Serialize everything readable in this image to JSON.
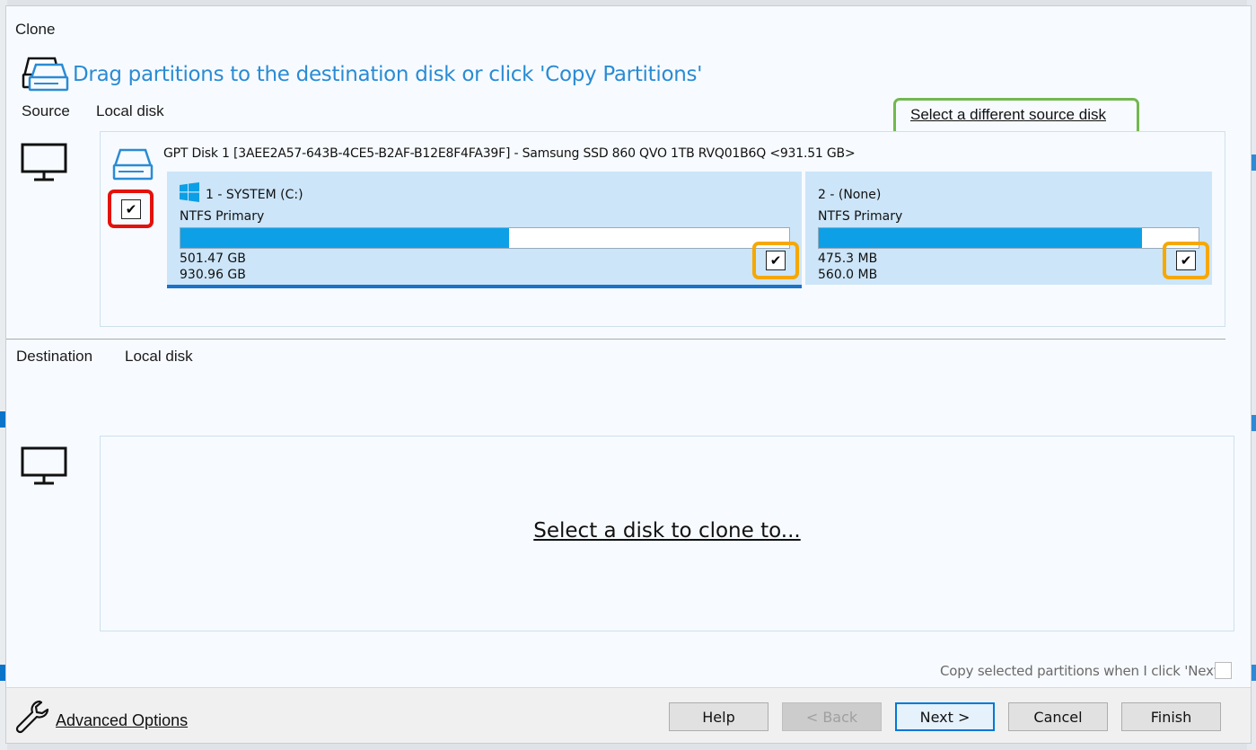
{
  "dialog": {
    "title": "Clone",
    "header": "Drag partitions to the destination disk or click 'Copy Partitions'"
  },
  "source": {
    "label": "Source",
    "type": "Local disk",
    "change_link": "Select a different source disk",
    "disk_title": "GPT Disk 1 [3AEE2A57-643B-4CE5-B2AF-B12E8F4FA39F] - Samsung SSD 860 QVO 1TB RVQ01B6Q  <931.51 GB>",
    "disk_checked": true,
    "partitions": [
      {
        "name": "1 - SYSTEM (C:)",
        "type": "NTFS Primary",
        "used": "501.47 GB",
        "total": "930.96 GB",
        "used_fraction": 0.54,
        "checked": true
      },
      {
        "name": "2 -  (None)",
        "type": "NTFS Primary",
        "used": "475.3 MB",
        "total": "560.0 MB",
        "used_fraction": 0.85,
        "checked": true
      }
    ]
  },
  "destination": {
    "label": "Destination",
    "type": "Local disk",
    "select_link": "Select a disk to clone to..."
  },
  "options": {
    "copy_on_next": "Copy selected partitions when I click 'Next'",
    "copy_on_next_checked": false
  },
  "footer": {
    "advanced": "Advanced Options",
    "help": "Help",
    "back": "< Back",
    "next": "Next >",
    "cancel": "Cancel",
    "finish": "Finish"
  },
  "colors": {
    "accent": "#2a8bd4",
    "bar": "#0ea0e6",
    "partition_bg": "#cce5f8",
    "highlight_red": "#e3120b",
    "highlight_orange": "#f6a800",
    "highlight_green": "#72b84f"
  }
}
